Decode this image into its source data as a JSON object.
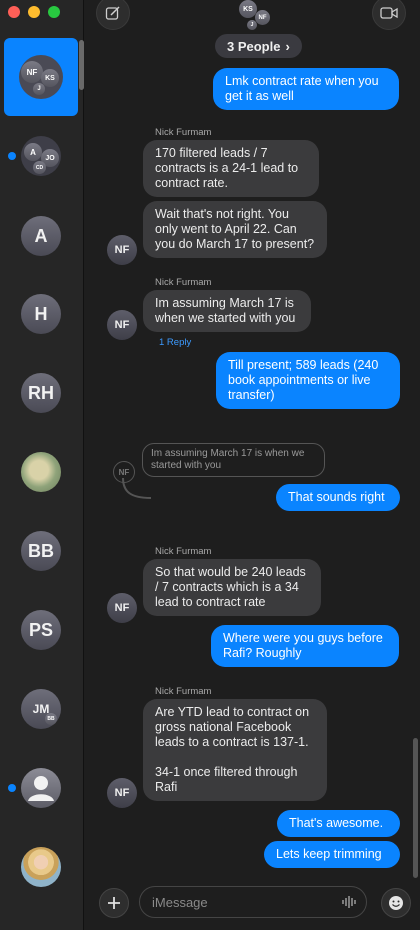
{
  "sidebar": {
    "selected_group": {
      "initials": [
        "NF",
        "KS",
        "J"
      ]
    },
    "group2": {
      "initials": [
        "A",
        "JO",
        "CD"
      ]
    },
    "contacts": [
      {
        "initials": "A"
      },
      {
        "initials": "H"
      },
      {
        "initials": "RH"
      },
      {
        "initials": "BB"
      },
      {
        "initials": "PS"
      },
      {
        "initials": "JM",
        "sub": "BB"
      }
    ]
  },
  "header": {
    "group_initials": [
      "KS",
      "NF",
      "J"
    ],
    "people_count": "3 People",
    "chevron": "›"
  },
  "messages": [
    {
      "text": "Lmk contract rate when you get it as well"
    },
    {
      "sender": "Nick Furmam",
      "text": "170 filtered leads / 7 contracts is a 24-1 lead to contract rate."
    },
    {
      "text": "Wait that's not right. You only went to April 22. Can you do March 17 to present?"
    },
    {
      "sender": "Nick Furmam",
      "text": "Im assuming March 17 is when we started with you",
      "reply_label": "1 Reply"
    },
    {
      "text": "Till present; 589 leads (240 book appointments or live transfer)"
    },
    {
      "quote": "Im assuming March 17 is when we started with you",
      "text": "That sounds right"
    },
    {
      "sender": "Nick Furmam",
      "text": "So that would be 240 leads / 7 contracts which is a 34 lead to contract rate"
    },
    {
      "text": "Where were you guys before Rafi? Roughly"
    },
    {
      "sender": "Nick Furmam",
      "text": "Are YTD lead to contract on gross national Facebook leads to a contract is 137-1.",
      "text2": "34-1 once filtered through Rafi"
    },
    {
      "text": "That's awesome."
    },
    {
      "text": "Lets keep trimming"
    }
  ],
  "avatar_label": "NF",
  "composer": {
    "placeholder": "iMessage"
  },
  "colors": {
    "outgoing": "#0a84ff",
    "incoming": "#3b3b3d",
    "background": "#1e1e1e"
  }
}
